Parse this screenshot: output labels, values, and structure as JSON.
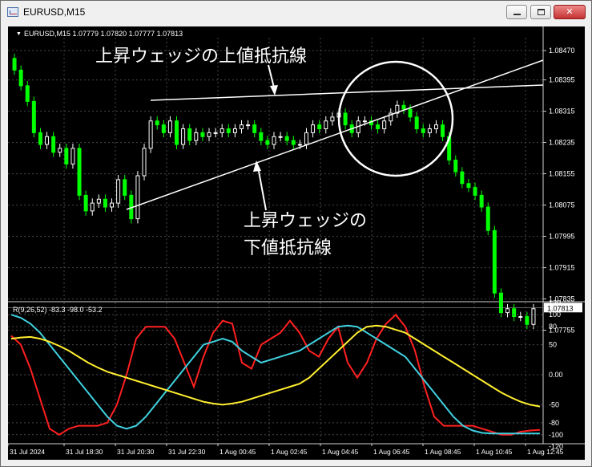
{
  "window": {
    "title": "EURUSD,M15",
    "buttons": [
      "minimize",
      "maximize",
      "close"
    ],
    "close_glyph": "✕"
  },
  "chart": {
    "header": "EURUSD,M15  1.07779 1.07820 1.07777 1.07813",
    "price_labels": [
      "1.08470",
      "1.08395",
      "1.08315",
      "1.08235",
      "1.08155",
      "1.08075",
      "1.07995",
      "1.07915",
      "1.07835",
      "1.07755"
    ],
    "current_price": "1.07813",
    "annotation_upper": "上昇ウェッジの上値抵抗線",
    "annotation_lower_line1": "上昇ウェッジの",
    "annotation_lower_line2": "下値抵抗線",
    "colors": {
      "bull": "#ffffff",
      "bear": "#00ff00",
      "grid": "#4a4a4a",
      "background": "#000000"
    }
  },
  "indicator": {
    "header": "R(9,26,52) -83.3 -98.0 -53.2",
    "levels": [
      "120",
      "100",
      "80",
      "50",
      "0.00",
      "-50",
      "-80",
      "-100",
      "-120"
    ],
    "colors": {
      "red": "#ff2020",
      "cyan": "#40d0e0",
      "yellow": "#ffee30"
    }
  },
  "time_axis": [
    "31 Jul 2024",
    "31 Jul 18:30",
    "31 Jul 20:30",
    "31 Jul 22:30",
    "1 Aug 00:45",
    "1 Aug 02:45",
    "1 Aug 04:45",
    "1 Aug 06:45",
    "1 Aug 08:45",
    "1 Aug 10:45",
    "1 Aug 12:45"
  ],
  "chart_data": {
    "type": "candlestick",
    "symbol": "EURUSD",
    "timeframe": "M15",
    "ohlc_last": {
      "open": 1.07779,
      "high": 1.0782,
      "low": 1.07777,
      "close": 1.07813
    },
    "ylim": [
      1.0775,
      1.0848
    ],
    "closes": [
      1.0842,
      1.0838,
      1.0834,
      1.0826,
      1.0823,
      1.0825,
      1.0821,
      1.0822,
      1.0818,
      1.0822,
      1.081,
      1.0806,
      1.0808,
      1.0809,
      1.0807,
      1.0808,
      1.0814,
      1.081,
      1.0804,
      1.0815,
      1.0822,
      1.0829,
      1.0828,
      1.0826,
      1.0829,
      1.0823,
      1.0827,
      1.0824,
      1.0826,
      1.0825,
      1.0826,
      1.0826,
      1.0827,
      1.0826,
      1.0827,
      1.0828,
      1.0828,
      1.0826,
      1.0824,
      1.0823,
      1.0825,
      1.0825,
      1.0824,
      1.0823,
      1.0823,
      1.0826,
      1.0828,
      1.0827,
      1.0829,
      1.083,
      1.0831,
      1.0828,
      1.0826,
      1.0829,
      1.0829,
      1.0828,
      1.0827,
      1.0829,
      1.0831,
      1.0833,
      1.0832,
      1.083,
      1.0827,
      1.0826,
      1.0827,
      1.0828,
      1.0825,
      1.0819,
      1.0816,
      1.0813,
      1.0812,
      1.081,
      1.0807,
      1.0801,
      1.0785,
      1.078,
      1.0781,
      1.0779,
      1.0779,
      1.0777,
      1.0781
    ],
    "indicator_series": [
      {
        "name": "",
        "color": "red",
        "values": [
          65,
          50,
          10,
          -40,
          -90,
          -100,
          -90,
          -85,
          -85,
          -85,
          -80,
          -50,
          0,
          60,
          80,
          80,
          80,
          60,
          20,
          -20,
          30,
          70,
          90,
          85,
          20,
          10,
          50,
          60,
          70,
          90,
          70,
          40,
          30,
          60,
          80,
          20,
          -5,
          20,
          60,
          85,
          100,
          80,
          40,
          -20,
          -70,
          -85,
          -85,
          -85,
          -85,
          -90,
          -95,
          -100,
          -100,
          -95,
          -93,
          -92
        ]
      },
      {
        "name": "",
        "color": "cyan",
        "values": [
          100,
          95,
          85,
          70,
          50,
          30,
          10,
          -10,
          -30,
          -50,
          -70,
          -85,
          -90,
          -85,
          -70,
          -50,
          -30,
          -10,
          10,
          30,
          50,
          55,
          60,
          55,
          40,
          30,
          20,
          25,
          30,
          35,
          40,
          50,
          60,
          70,
          80,
          82,
          80,
          70,
          60,
          50,
          40,
          30,
          10,
          -10,
          -30,
          -50,
          -70,
          -85,
          -93,
          -97,
          -98,
          -98,
          -98,
          -98,
          -98,
          -98
        ]
      },
      {
        "name": "",
        "color": "yellow",
        "values": [
          60,
          62,
          63,
          60,
          55,
          48,
          40,
          30,
          20,
          12,
          5,
          0,
          -5,
          -10,
          -15,
          -20,
          -25,
          -30,
          -35,
          -40,
          -45,
          -48,
          -50,
          -48,
          -45,
          -40,
          -35,
          -30,
          -25,
          -20,
          -15,
          -5,
          10,
          25,
          40,
          55,
          70,
          80,
          82,
          80,
          75,
          70,
          60,
          50,
          40,
          30,
          20,
          10,
          0,
          -10,
          -20,
          -30,
          -38,
          -45,
          -50,
          -53
        ]
      }
    ]
  }
}
